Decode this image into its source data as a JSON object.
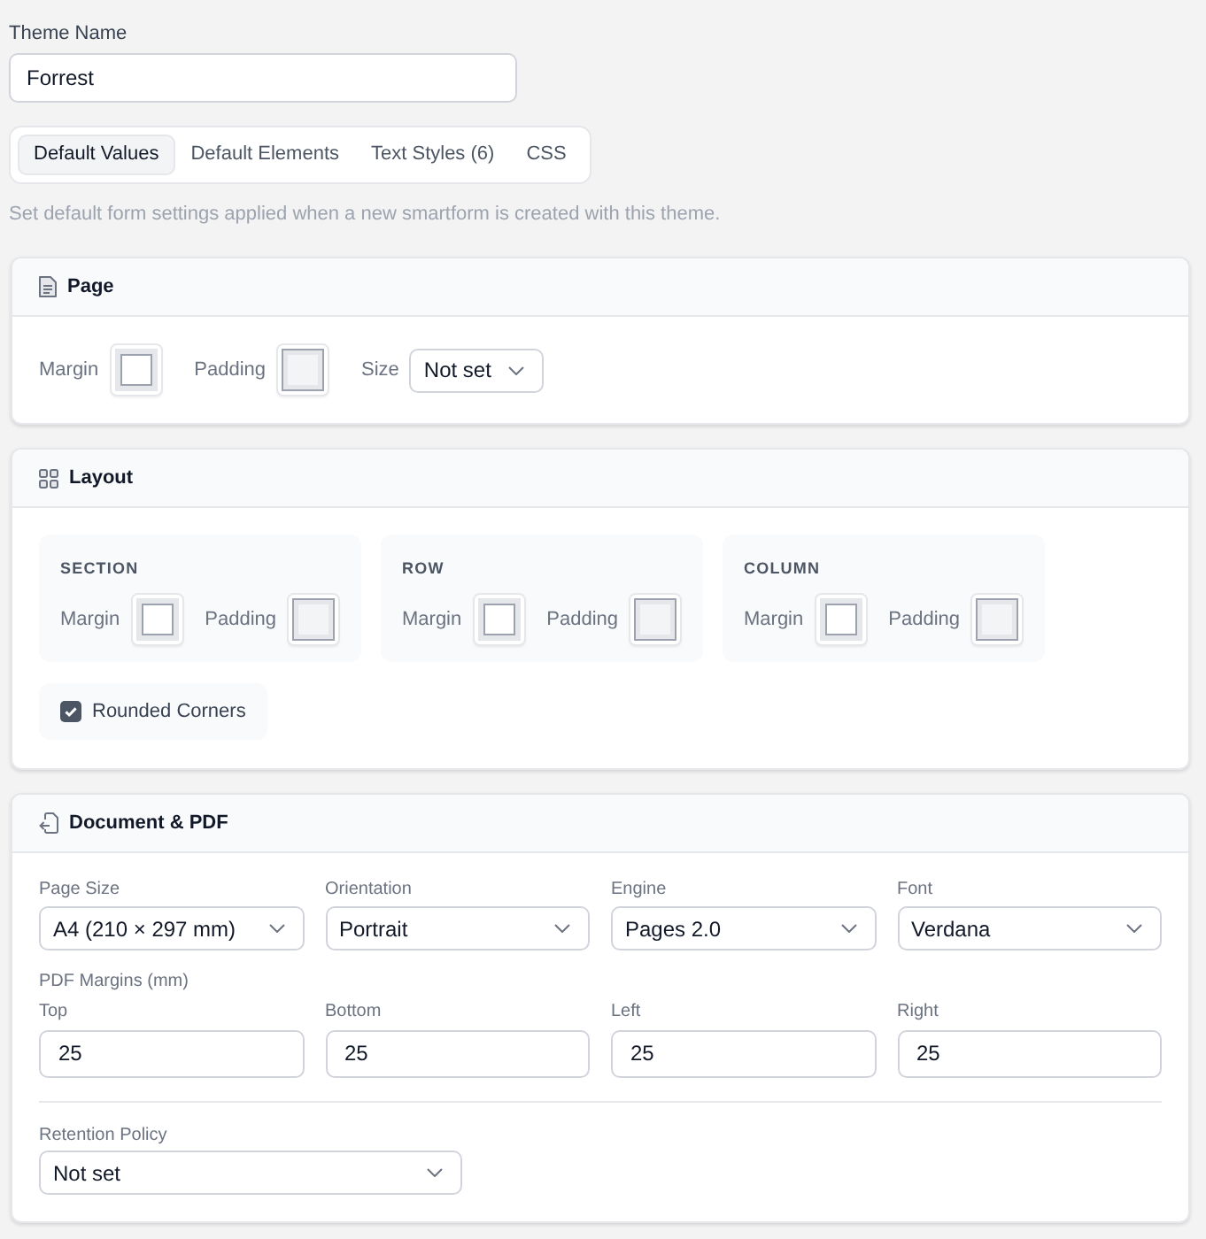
{
  "theme_name": {
    "label": "Theme Name",
    "value": "Forrest"
  },
  "tabs": [
    {
      "label": "Default Values",
      "selected": true
    },
    {
      "label": "Default Elements",
      "selected": false
    },
    {
      "label": "Text Styles (6)",
      "selected": false
    },
    {
      "label": "CSS",
      "selected": false
    }
  ],
  "description": "Set default form settings applied when a new smartform is created with this theme.",
  "page": {
    "title": "Page",
    "fields": [
      {
        "kind": "margin",
        "label": "Margin"
      },
      {
        "kind": "padding",
        "label": "Padding"
      },
      {
        "kind": "select",
        "label": "Size",
        "value": "Not set"
      }
    ]
  },
  "layout": {
    "title": "Layout",
    "groups": [
      {
        "heading": "SECTION",
        "fields": [
          {
            "kind": "margin",
            "label": "Margin"
          },
          {
            "kind": "padding",
            "label": "Padding"
          }
        ]
      },
      {
        "heading": "ROW",
        "fields": [
          {
            "kind": "margin",
            "label": "Margin"
          },
          {
            "kind": "padding",
            "label": "Padding"
          }
        ]
      },
      {
        "heading": "COLUMN",
        "fields": [
          {
            "kind": "margin",
            "label": "Margin"
          },
          {
            "kind": "padding",
            "label": "Padding"
          }
        ]
      }
    ],
    "rounded_corners": {
      "label": "Rounded Corners",
      "checked": true
    }
  },
  "document": {
    "title": "Document & PDF",
    "selects": [
      {
        "label": "Page Size",
        "value": "A4 (210 × 297 mm)"
      },
      {
        "label": "Orientation",
        "value": "Portrait"
      },
      {
        "label": "Engine",
        "value": "Pages 2.0"
      },
      {
        "label": "Font",
        "value": "Verdana"
      }
    ],
    "margins_heading": "PDF Margins (mm)",
    "margins": [
      {
        "label": "Top",
        "value": "25"
      },
      {
        "label": "Bottom",
        "value": "25"
      },
      {
        "label": "Left",
        "value": "25"
      },
      {
        "label": "Right",
        "value": "25"
      }
    ],
    "retention": {
      "label": "Retention Policy",
      "value": "Not set"
    }
  }
}
